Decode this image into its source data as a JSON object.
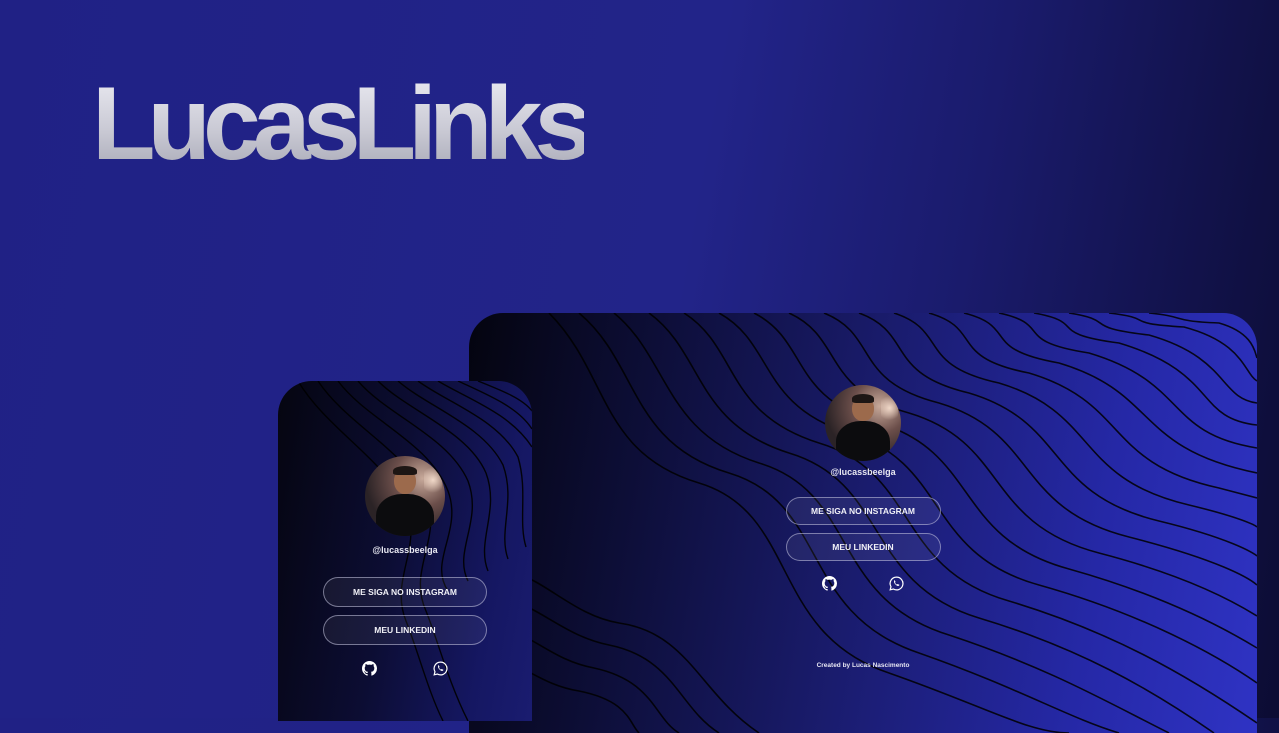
{
  "brand": {
    "title": "LucasLinks"
  },
  "desktop": {
    "handle": "@lucassbeelga",
    "buttons": [
      "ME SIGA NO INSTAGRAM",
      "MEU LINKEDIN"
    ],
    "social_icons": [
      "github-icon",
      "whatsapp-icon"
    ],
    "footer": "Created by Lucas Nascimento"
  },
  "mobile": {
    "handle": "@lucassbeelga",
    "buttons": [
      "ME SIGA NO INSTAGRAM",
      "MEU LINKEDIN"
    ],
    "social_icons": [
      "github-icon",
      "whatsapp-icon"
    ]
  },
  "colors": {
    "background": "#222489",
    "device_dark": "#04040f",
    "device_light": "#2f33c4",
    "button_border": "#c8c8e1",
    "text": "#f1f1f7"
  }
}
